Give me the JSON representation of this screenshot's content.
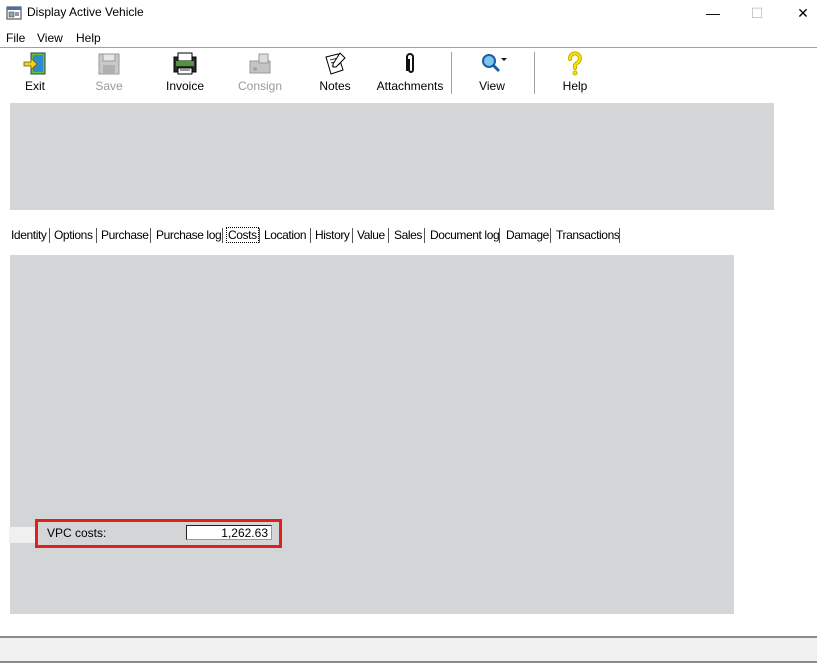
{
  "window": {
    "title": "Display Active Vehicle",
    "minimize_glyph": "—",
    "maximize_glyph": "☐",
    "close_glyph": "✕"
  },
  "menu": {
    "items": [
      "File",
      "View",
      "Help"
    ]
  },
  "toolbar": {
    "buttons": [
      {
        "label": "Exit",
        "icon": "exit-icon",
        "enabled": true
      },
      {
        "label": "Save",
        "icon": "save-icon",
        "enabled": false
      },
      {
        "label": "Invoice",
        "icon": "invoice-icon",
        "enabled": true
      },
      {
        "label": "Consign",
        "icon": "consign-icon",
        "enabled": false
      },
      {
        "label": "Notes",
        "icon": "notes-icon",
        "enabled": true
      },
      {
        "label": "Attachments",
        "icon": "paperclip-icon",
        "enabled": true
      },
      {
        "label": "View",
        "icon": "magnifier-icon",
        "enabled": true
      },
      {
        "label": "Help",
        "icon": "question-icon",
        "enabled": true
      }
    ]
  },
  "tabs": {
    "items": [
      "Identity",
      "Options",
      "Purchase",
      "Purchase log",
      "Costs",
      "Location",
      "History",
      "Value",
      "Sales",
      "Document log",
      "Damage",
      "Transactions"
    ],
    "active": "Costs"
  },
  "costs": {
    "vpc_label": "VPC costs:",
    "vpc_value": "1,262.63"
  },
  "colors": {
    "panel_gray": "#d4d5d7",
    "highlight_red": "#e0201e"
  }
}
